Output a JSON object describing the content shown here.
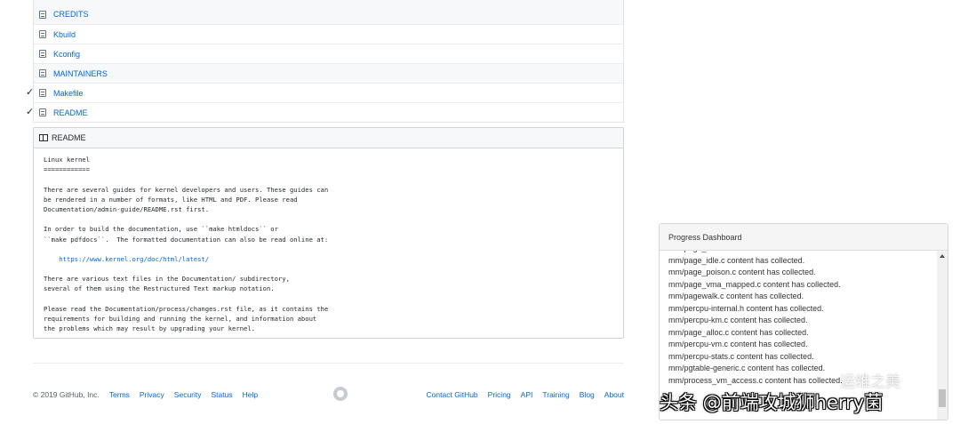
{
  "files": [
    {
      "name": "CREDITS",
      "checked": false
    },
    {
      "name": "Kbuild",
      "checked": false
    },
    {
      "name": "Kconfig",
      "checked": false
    },
    {
      "name": "MAINTAINERS",
      "checked": false
    },
    {
      "name": "Makefile",
      "checked": true
    },
    {
      "name": "README",
      "checked": true
    }
  ],
  "check_glyph": "✓",
  "readme": {
    "title": "README",
    "lines": [
      "Linux kernel",
      "============",
      "",
      "There are several guides for kernel developers and users. These guides can",
      "be rendered in a number of formats, like HTML and PDF. Please read",
      "Documentation/admin-guide/README.rst first.",
      "",
      "In order to build the documentation, use ``make htmldocs`` or",
      "``make pdfdocs``.  The formatted documentation can also be read online at:",
      "",
      "    https://www.kernel.org/doc/html/latest/",
      "",
      "There are various text files in the Documentation/ subdirectory,",
      "several of them using the Restructured Text markup notation.",
      "",
      "Please read the Documentation/process/changes.rst file, as it contains the",
      "requirements for building and running the kernel, and information about",
      "the problems which may result by upgrading your kernel."
    ],
    "link_line_index": 10
  },
  "footer": {
    "copyright": "© 2019 GitHub, Inc.",
    "left_links": [
      "Terms",
      "Privacy",
      "Security",
      "Status",
      "Help"
    ],
    "right_links": [
      "Contact GitHub",
      "Pricing",
      "API",
      "Training",
      "Blog",
      "About"
    ]
  },
  "dashboard": {
    "title": "Progress Dashboard",
    "log": [
      "mm/page_writeback.c content has collected.",
      "mm/page_idle.c content has collected.",
      "mm/page_poison.c content has collected.",
      "mm/page_vma_mapped.c content has collected.",
      "mm/pagewalk.c content has collected.",
      "mm/percpu-internal.h content has collected.",
      "mm/percpu-km.c content has collected.",
      "mm/page_alloc.c content has collected.",
      "mm/percpu-vm.c content has collected.",
      "mm/percpu-stats.c content has collected.",
      "mm/pgtable-generic.c content has collected.",
      "mm/process_vm_access.c content has collected."
    ]
  },
  "watermark": {
    "top": "运维之美",
    "bottom": "头条 @前端攻城狮herry菌"
  }
}
